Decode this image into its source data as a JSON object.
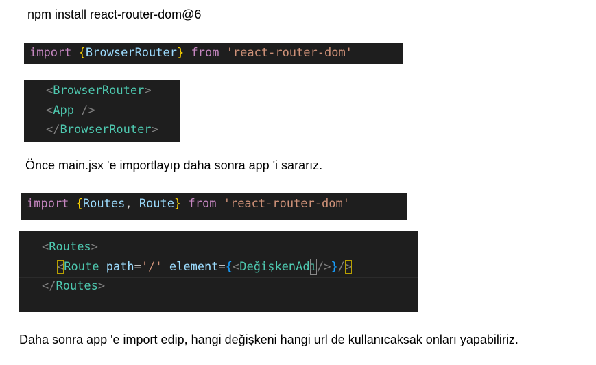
{
  "line1": "npm install react-router-dom@6",
  "code1": {
    "kw_import": "import",
    "brace_open": "{",
    "ident": "BrowserRouter",
    "brace_close": "}",
    "kw_from": "from",
    "str": "'react-router-dom'"
  },
  "code2": {
    "l1_open": "<",
    "l1_tag": "BrowserRouter",
    "l1_close": ">",
    "l2_open": "<",
    "l2_tag": "App",
    "l2_close": " />",
    "l3_open": "</",
    "l3_tag": "BrowserRouter",
    "l3_close": ">"
  },
  "line2": "Önce main.jsx 'e importlayıp daha sonra app 'i sararız.",
  "code3": {
    "kw_import": "import",
    "brace_open": "{",
    "ident1": "Routes",
    "comma": ", ",
    "ident2": "Route",
    "brace_close": "}",
    "kw_from": "from",
    "str": "'react-router-dom'"
  },
  "code4": {
    "l1_open": "<",
    "l1_tag": "Routes",
    "l1_close": ">",
    "l2_open": "<",
    "l2_tag": "Route",
    "l2_attr1": "path",
    "l2_eq1": "=",
    "l2_val1": "'/'",
    "l2_attr2": "element",
    "l2_eq2": "=",
    "l2_brace_open": "{",
    "l2_inner_open": "<",
    "l2_inner_tag_a": "DeğişkenAd",
    "l2_inner_tag_b": "ı",
    "l2_inner_close": "/>",
    "l2_brace_close": "}",
    "l2_end_a": "/",
    "l2_end_b": ">",
    "l3_open": "</",
    "l3_tag": "Routes",
    "l3_close": ">"
  },
  "line3": "Daha sonra app 'e import edip, hangi değişkeni hangi url de kullanıcaksak onları yapabiliriz."
}
